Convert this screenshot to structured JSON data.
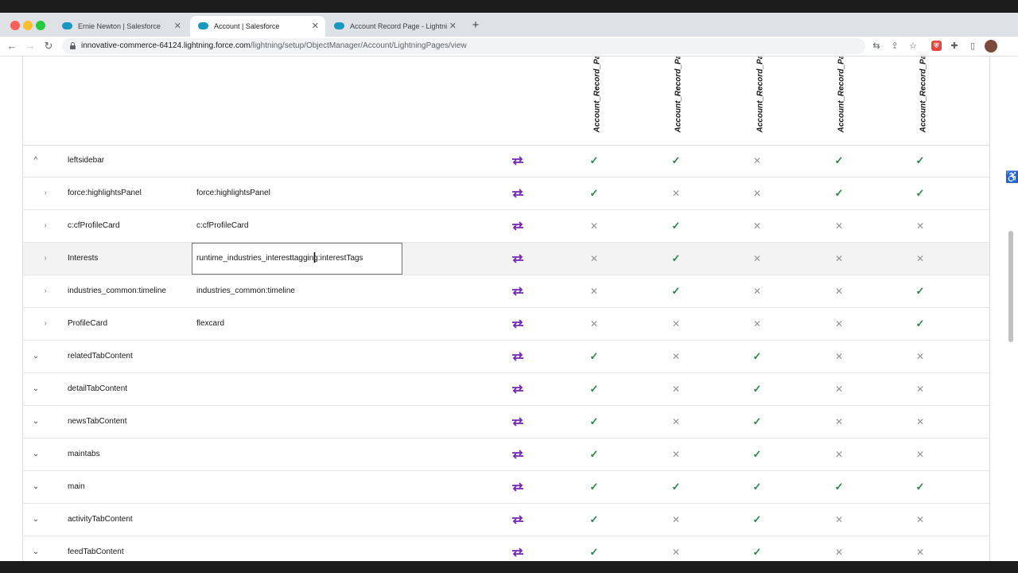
{
  "browser": {
    "tabs": [
      {
        "title": "Ernie Newton | Salesforce",
        "active": false
      },
      {
        "title": "Account | Salesforce",
        "active": true
      },
      {
        "title": "Account Record Page - Lightni",
        "active": false
      }
    ],
    "url_host": "innovative-commerce-64124.lightning.force.com",
    "url_path": "/lightning/setup/ObjectManager/Account/LightningPages/view"
  },
  "icons": {
    "yes": "✓",
    "no": "✕",
    "expanded": "^",
    "collapsed": "⌄",
    "child": "›",
    "cursor": "I"
  },
  "colors": {
    "check": "#2e844a",
    "cross": "#939393",
    "swap": "#7526b5"
  },
  "table": {
    "columns": [
      "Account_Record_Pa",
      "Account_Record_Pa",
      "Account_Record_Pa",
      "Account_Record_Pa",
      "Account_Record_Pa"
    ],
    "rows": [
      {
        "name": "leftsidebar",
        "value": "",
        "level": 1,
        "chevron": "expanded",
        "marks": [
          true,
          true,
          false,
          true,
          true
        ]
      },
      {
        "name": "force:highlightsPanel",
        "value": "force:highlightsPanel",
        "level": 2,
        "chevron": "child",
        "marks": [
          true,
          false,
          false,
          true,
          true
        ]
      },
      {
        "name": "c:cfProfileCard",
        "value": "c:cfProfileCard",
        "level": 2,
        "chevron": "child",
        "marks": [
          false,
          true,
          false,
          false,
          false
        ]
      },
      {
        "name": "Interests",
        "value": "runtime_industries_interesttagging:interestTags",
        "level": 2,
        "chevron": "child",
        "marks": [
          false,
          true,
          false,
          false,
          false
        ],
        "highlighted": true
      },
      {
        "name": "industries_common:timeline",
        "value": "industries_common:timeline",
        "level": 2,
        "chevron": "child",
        "marks": [
          false,
          true,
          false,
          false,
          true
        ]
      },
      {
        "name": "ProfileCard",
        "value": "flexcard",
        "level": 2,
        "chevron": "child",
        "marks": [
          false,
          false,
          false,
          false,
          true
        ]
      },
      {
        "name": "relatedTabContent",
        "value": "",
        "level": 1,
        "chevron": "collapsed",
        "marks": [
          true,
          false,
          true,
          false,
          false
        ]
      },
      {
        "name": "detailTabContent",
        "value": "",
        "level": 1,
        "chevron": "collapsed",
        "marks": [
          true,
          false,
          true,
          false,
          false
        ]
      },
      {
        "name": "newsTabContent",
        "value": "",
        "level": 1,
        "chevron": "collapsed",
        "marks": [
          true,
          false,
          true,
          false,
          false
        ]
      },
      {
        "name": "maintabs",
        "value": "",
        "level": 1,
        "chevron": "collapsed",
        "marks": [
          true,
          false,
          true,
          false,
          false
        ]
      },
      {
        "name": "main",
        "value": "",
        "level": 1,
        "chevron": "collapsed",
        "marks": [
          true,
          true,
          true,
          true,
          true
        ]
      },
      {
        "name": "activityTabContent",
        "value": "",
        "level": 1,
        "chevron": "collapsed",
        "marks": [
          true,
          false,
          true,
          false,
          false
        ]
      },
      {
        "name": "feedTabContent",
        "value": "",
        "level": 1,
        "chevron": "collapsed",
        "marks": [
          true,
          false,
          true,
          false,
          false
        ]
      }
    ]
  }
}
